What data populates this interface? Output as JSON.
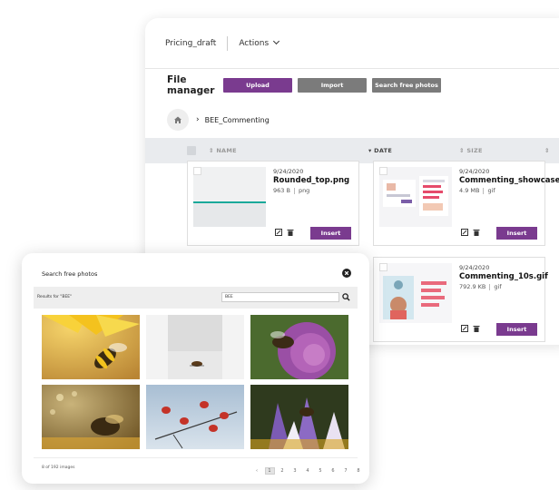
{
  "top_bar": {
    "draft_name": "Pricing_draft",
    "actions_label": "Actions"
  },
  "file_manager": {
    "title": "File manager",
    "upload_label": "Upload",
    "import_label": "Import",
    "search_photos_label": "Search free photos",
    "breadcrumb": "BEE_Commenting",
    "columns": {
      "name": "NAME",
      "date": "DATE",
      "size": "SIZE"
    },
    "files": [
      {
        "date": "9/24/2020",
        "name": "Rounded_top.png",
        "size": "963 B",
        "type": "png",
        "insert": "Insert"
      },
      {
        "date": "9/24/2020",
        "name": "Commenting_showcase",
        "size": "4.9 MB",
        "type": "gif",
        "insert": "Insert"
      },
      {
        "date": "9/24/2020",
        "name": "Commenting_10s.gif",
        "size": "792.9 KB",
        "type": "gif",
        "insert": "Insert"
      }
    ]
  },
  "search_photos": {
    "title": "Search free photos",
    "results_label": "Results for \"BEE\"",
    "query": "BEE",
    "footer": "8 of 192 images",
    "pager": {
      "prev": "‹",
      "pages": [
        "1",
        "2",
        "3",
        "4",
        "5",
        "6",
        "7",
        "8"
      ],
      "next": "›",
      "current": "1"
    }
  },
  "colors": {
    "accent": "#7a3b8f",
    "grey_button": "#7b7b7b"
  },
  "icons": [
    "home-icon",
    "chevron-down-icon",
    "sort-icon",
    "edit-icon",
    "trash-icon",
    "close-icon",
    "search-icon"
  ]
}
